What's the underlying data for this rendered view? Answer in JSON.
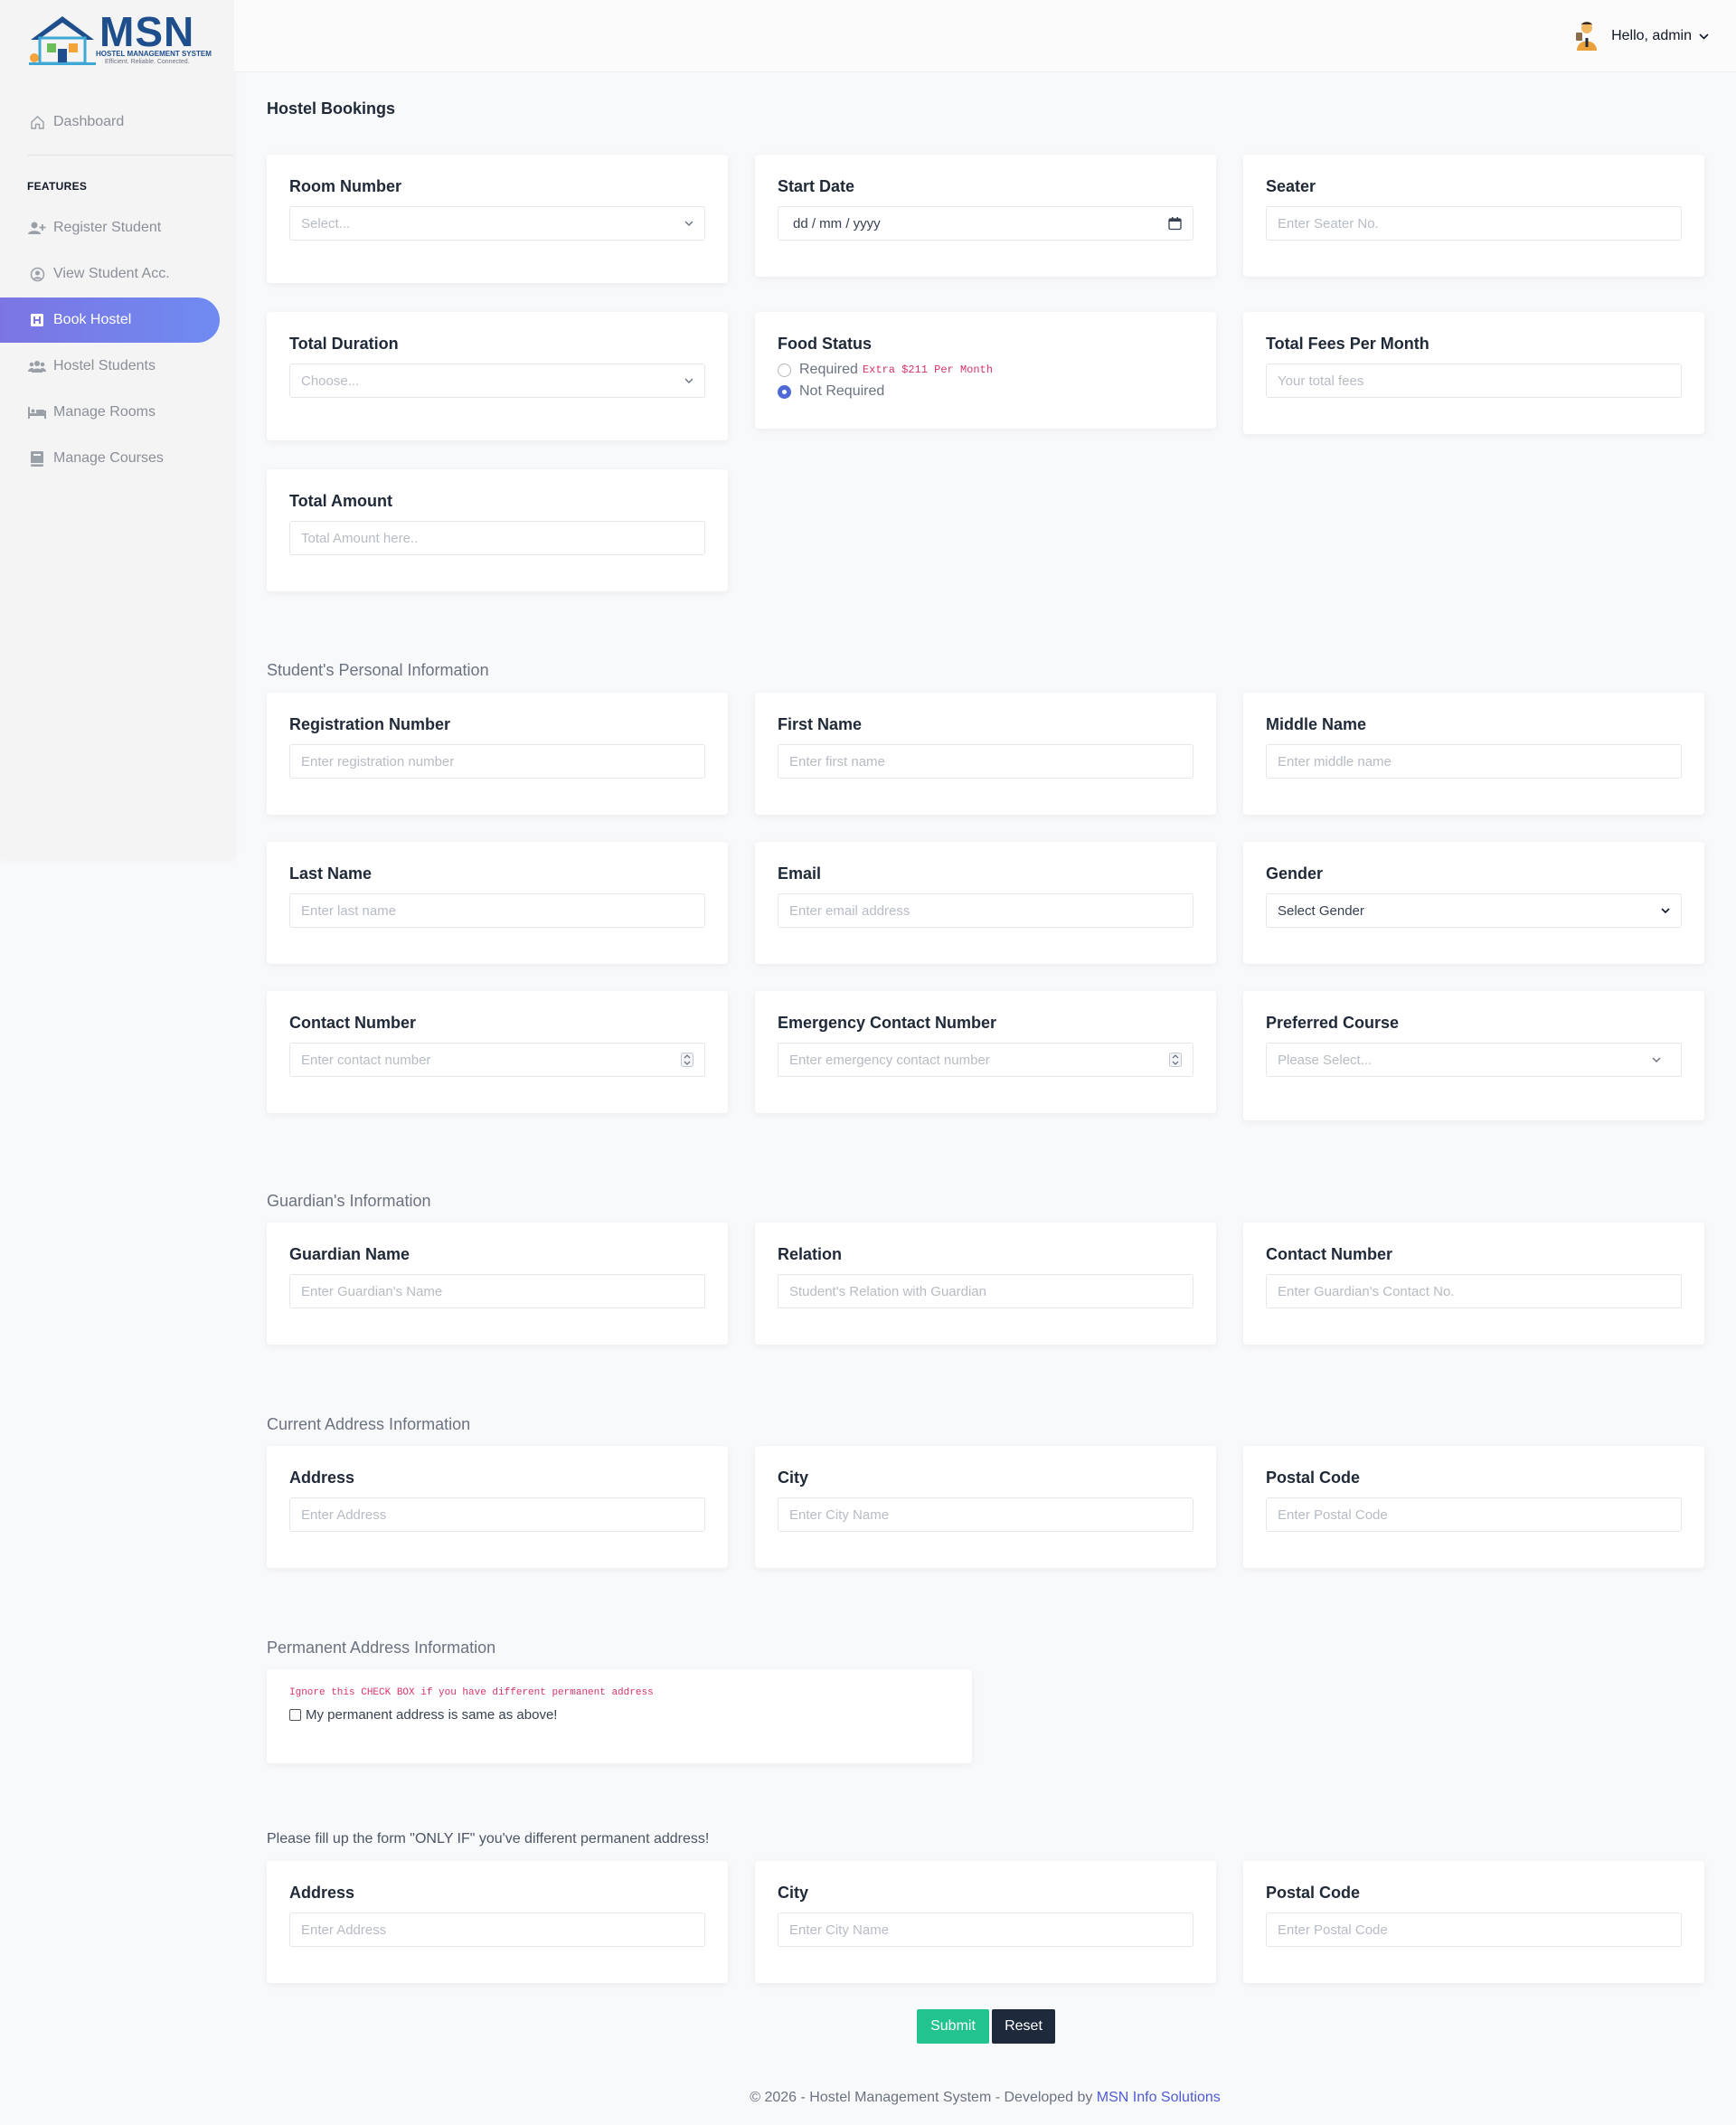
{
  "brand": {
    "name": "MSN",
    "subtitle": "HOSTEL MANAGEMENT SYSTEM",
    "tagline": "Efficient. Reliable. Connected.",
    "accent": "#1f4e8c"
  },
  "topbar": {
    "greeting": "Hello, admin"
  },
  "sidebar": {
    "dashboard": "Dashboard",
    "features_heading": "FEATURES",
    "items": [
      {
        "label": "Register Student",
        "icon": "user-plus-icon"
      },
      {
        "label": "View Student Acc.",
        "icon": "user-circle-icon"
      },
      {
        "label": "Book Hostel",
        "icon": "hostel-icon",
        "active": true
      },
      {
        "label": "Hostel Students",
        "icon": "users-icon"
      },
      {
        "label": "Manage Rooms",
        "icon": "bed-icon"
      },
      {
        "label": "Manage Courses",
        "icon": "book-icon"
      }
    ],
    "active_color": "#7b75e3"
  },
  "booking": {
    "title": "Hostel Bookings",
    "room_number": {
      "label": "Room Number",
      "value": "Select..."
    },
    "start_date": {
      "label": "Start Date",
      "value": "dd / mm / yyyy"
    },
    "seater": {
      "label": "Seater",
      "placeholder": "Enter Seater No."
    },
    "total_duration": {
      "label": "Total Duration",
      "value": "Choose..."
    },
    "food_status": {
      "label": "Food Status",
      "option_required": "Required",
      "extra_note": "Extra $211 Per Month",
      "option_not_required": "Not Required"
    },
    "total_fees": {
      "label": "Total Fees Per Month",
      "placeholder": "Your total fees"
    },
    "total_amount": {
      "label": "Total Amount",
      "placeholder": "Total Amount here.."
    }
  },
  "personal": {
    "title": "Student's Personal Information",
    "registration": {
      "label": "Registration Number",
      "placeholder": "Enter registration number"
    },
    "first_name": {
      "label": "First Name",
      "placeholder": "Enter first name"
    },
    "middle_name": {
      "label": "Middle Name",
      "placeholder": "Enter middle name"
    },
    "last_name": {
      "label": "Last Name",
      "placeholder": "Enter last name"
    },
    "email": {
      "label": "Email",
      "placeholder": "Enter email address"
    },
    "gender": {
      "label": "Gender",
      "value": "Select Gender"
    },
    "contact": {
      "label": "Contact Number",
      "placeholder": "Enter contact number"
    },
    "emergency": {
      "label": "Emergency Contact Number",
      "placeholder": "Enter emergency contact number"
    },
    "course": {
      "label": "Preferred Course",
      "value": "Please Select..."
    }
  },
  "guardian": {
    "title": "Guardian's Information",
    "name": {
      "label": "Guardian Name",
      "placeholder": "Enter Guardian's Name"
    },
    "relation": {
      "label": "Relation",
      "placeholder": "Student's Relation with Guardian"
    },
    "contact": {
      "label": "Contact Number",
      "placeholder": "Enter Guardian's Contact No."
    }
  },
  "current_address": {
    "title": "Current Address Information",
    "address": {
      "label": "Address",
      "placeholder": "Enter Address"
    },
    "city": {
      "label": "City",
      "placeholder": "Enter City Name"
    },
    "postal": {
      "label": "Postal Code",
      "placeholder": "Enter Postal Code"
    }
  },
  "permanent": {
    "title": "Permanent Address Information",
    "note": "Ignore this CHECK BOX if you have different permanent address",
    "checkbox_label": "My permanent address is same as above!",
    "form_note": "Please fill up the form \"ONLY IF\" you've different permanent address!",
    "address": {
      "label": "Address",
      "placeholder": "Enter Address"
    },
    "city": {
      "label": "City",
      "placeholder": "Enter City Name"
    },
    "postal": {
      "label": "Postal Code",
      "placeholder": "Enter Postal Code"
    }
  },
  "actions": {
    "submit": "Submit",
    "reset": "Reset"
  },
  "footer": {
    "text": "© 2026 - Hostel Management System - Developed by",
    "link": "MSN Info Solutions"
  }
}
